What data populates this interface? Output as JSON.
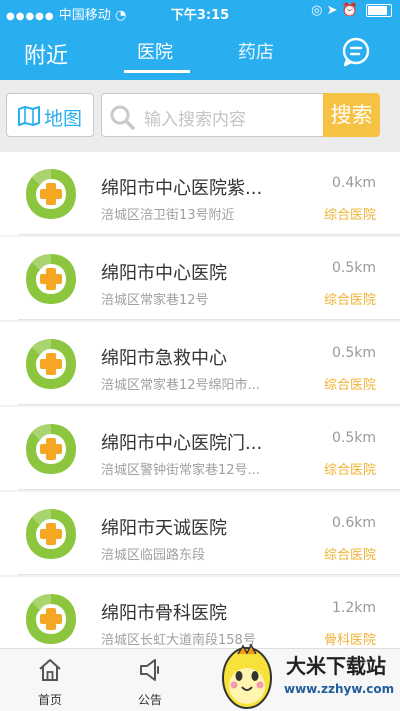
{
  "status_bar": {
    "carrier": "中国移动",
    "time": "下午3:15"
  },
  "header": {
    "near_label": "附近",
    "tabs": [
      "医院",
      "药店"
    ],
    "active_tab": "医院"
  },
  "search": {
    "map_button": "地图",
    "placeholder": "输入搜索内容",
    "search_button": "搜索"
  },
  "hospitals": [
    {
      "name": "绵阳市中心医院紫...",
      "address": "涪城区涪卫街13号附近",
      "distance": "0.4km",
      "type": "综合医院"
    },
    {
      "name": "绵阳市中心医院",
      "address": "涪城区常家巷12号",
      "distance": "0.5km",
      "type": "综合医院"
    },
    {
      "name": "绵阳市急救中心",
      "address": "涪城区常家巷12号绵阳市...",
      "distance": "0.5km",
      "type": "综合医院"
    },
    {
      "name": "绵阳市中心医院门...",
      "address": "涪城区警钟街常家巷12号...",
      "distance": "0.5km",
      "type": "综合医院"
    },
    {
      "name": "绵阳市天诚医院",
      "address": "涪城区临园路东段",
      "distance": "0.6km",
      "type": "综合医院"
    },
    {
      "name": "绵阳市骨科医院",
      "address": "涪城区长虹大道南段158号",
      "distance": "1.2km",
      "type": "骨科医院"
    }
  ],
  "bottom_nav": {
    "home": "首页",
    "notice": "公告"
  },
  "watermark": {
    "title": "大米下载站",
    "url": "www.zzhyw.com"
  },
  "colors": {
    "primary": "#29aef0",
    "accent": "#f6c243",
    "logo_green": "#8cc63f",
    "logo_orange": "#f5a623"
  }
}
